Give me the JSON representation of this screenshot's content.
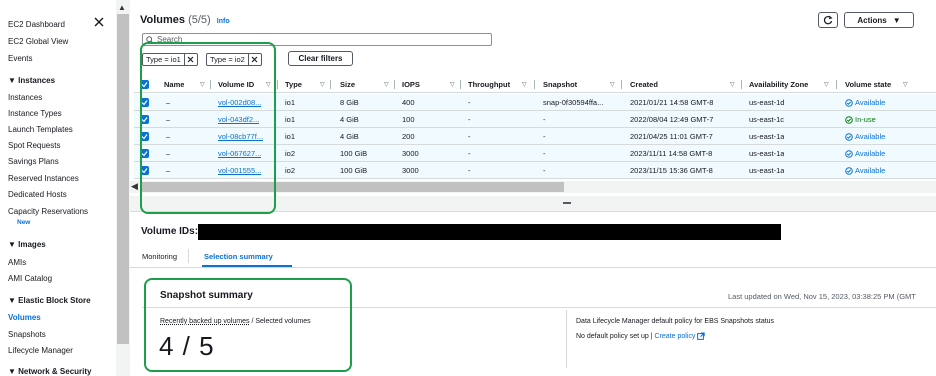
{
  "sidebar": {
    "close_icon": "close-icon",
    "items": [
      {
        "label": "EC2 Dashboard",
        "type": "link"
      },
      {
        "label": "EC2 Global View",
        "type": "link"
      },
      {
        "label": "Events",
        "type": "link"
      },
      {
        "label": "Instances",
        "type": "section"
      },
      {
        "label": "Instances",
        "type": "link"
      },
      {
        "label": "Instance Types",
        "type": "link"
      },
      {
        "label": "Launch Templates",
        "type": "link"
      },
      {
        "label": "Spot Requests",
        "type": "link"
      },
      {
        "label": "Savings Plans",
        "type": "link"
      },
      {
        "label": "Reserved Instances",
        "type": "link"
      },
      {
        "label": "Dedicated Hosts",
        "type": "link"
      },
      {
        "label": "Capacity Reservations",
        "type": "link"
      },
      {
        "label": "Images",
        "type": "section"
      },
      {
        "label": "AMIs",
        "type": "link"
      },
      {
        "label": "AMI Catalog",
        "type": "link"
      },
      {
        "label": "Elastic Block Store",
        "type": "section"
      },
      {
        "label": "Volumes",
        "type": "active"
      },
      {
        "label": "Snapshots",
        "type": "link"
      },
      {
        "label": "Lifecycle Manager",
        "type": "link"
      },
      {
        "label": "Network & Security",
        "type": "section"
      }
    ],
    "new_badge": "New"
  },
  "header": {
    "title": "Volumes",
    "count": "(5/5)",
    "info": "Info",
    "actions_label": "Actions"
  },
  "search": {
    "placeholder": "Search"
  },
  "filters": {
    "tokens": [
      "Type = io1",
      "Type = io2"
    ],
    "clear_label": "Clear filters"
  },
  "table": {
    "columns": [
      "Name",
      "Volume ID",
      "Type",
      "Size",
      "IOPS",
      "Throughput",
      "Snapshot",
      "Created",
      "Availability Zone",
      "Volume state"
    ],
    "rows": [
      {
        "name": "–",
        "volume_id": "vol-002d08...",
        "type": "io1",
        "size": "8 GiB",
        "iops": "400",
        "throughput": "-",
        "snapshot": "snap-0f30594ffa...",
        "created": "2021/01/21 14:58 GMT-8",
        "az": "us-east-1d",
        "state": "Available"
      },
      {
        "name": "–",
        "volume_id": "vol-043df2...",
        "type": "io1",
        "size": "4 GiB",
        "iops": "100",
        "throughput": "-",
        "snapshot": "-",
        "created": "2022/08/04 12:49 GMT-7",
        "az": "us-east-1c",
        "state": "In-use"
      },
      {
        "name": "–",
        "volume_id": "vol-08cb77f...",
        "type": "io1",
        "size": "4 GiB",
        "iops": "200",
        "throughput": "-",
        "snapshot": "-",
        "created": "2021/04/25 11:01 GMT-7",
        "az": "us-east-1a",
        "state": "Available"
      },
      {
        "name": "–",
        "volume_id": "vol-067627...",
        "type": "io2",
        "size": "100 GiB",
        "iops": "3000",
        "throughput": "-",
        "snapshot": "-",
        "created": "2023/11/11 14:58 GMT-8",
        "az": "us-east-1a",
        "state": "Available"
      },
      {
        "name": "–",
        "volume_id": "vol-001555...",
        "type": "io2",
        "size": "100 GiB",
        "iops": "3000",
        "throughput": "-",
        "snapshot": "-",
        "created": "2023/11/15 15:36 GMT-8",
        "az": "us-east-1a",
        "state": "Available"
      }
    ]
  },
  "details": {
    "volume_ids_label": "Volume IDs:",
    "tabs": [
      "Monitoring",
      "Selection summary"
    ],
    "snapshot_summary_title": "Snapshot summary",
    "last_updated": "Last updated on Wed, Nov 15, 2023, 03:38:25 PM (GMT",
    "recently_backed_up": "Recently backed up volumes",
    "selected_volumes": "/ Selected volumes",
    "ratio": "4 / 5",
    "dlm_status": "Data Lifecycle Manager default policy for EBS Snapshots status",
    "no_default_policy": "No default policy set up |",
    "create_policy": "Create policy"
  },
  "colors": {
    "accent": "#0972d3",
    "in_use": "#037f0c",
    "highlight_box": "#1d9e4a",
    "row_selected": "#f1faff"
  }
}
